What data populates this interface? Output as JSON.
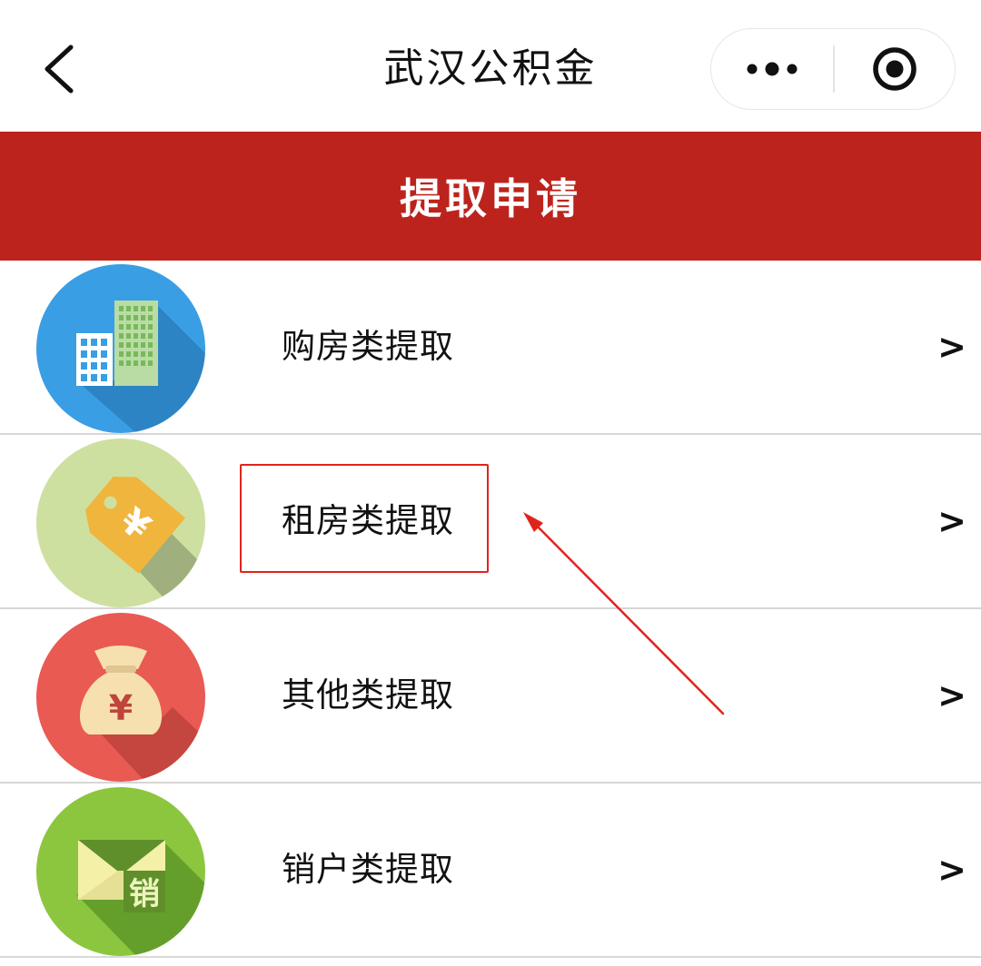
{
  "nav": {
    "title": "武汉公积金",
    "back_icon": "chevron-left-icon",
    "more_icon": "more-dots-icon",
    "close_icon": "target-circle-icon"
  },
  "banner": {
    "title": "提取申请",
    "color": "#bd231d"
  },
  "menu": {
    "items": [
      {
        "label": "购房类提取",
        "icon": "buildings-icon",
        "arrow": ">"
      },
      {
        "label": "租房类提取",
        "icon": "price-tag-yuan-icon",
        "arrow": ">"
      },
      {
        "label": "其他类提取",
        "icon": "money-bag-yuan-icon",
        "arrow": ">"
      },
      {
        "label": "销户类提取",
        "icon": "envelope-xiao-icon",
        "arrow": ">",
        "icon_text": "销"
      }
    ]
  },
  "annotation": {
    "highlight_color": "#e0241d"
  }
}
